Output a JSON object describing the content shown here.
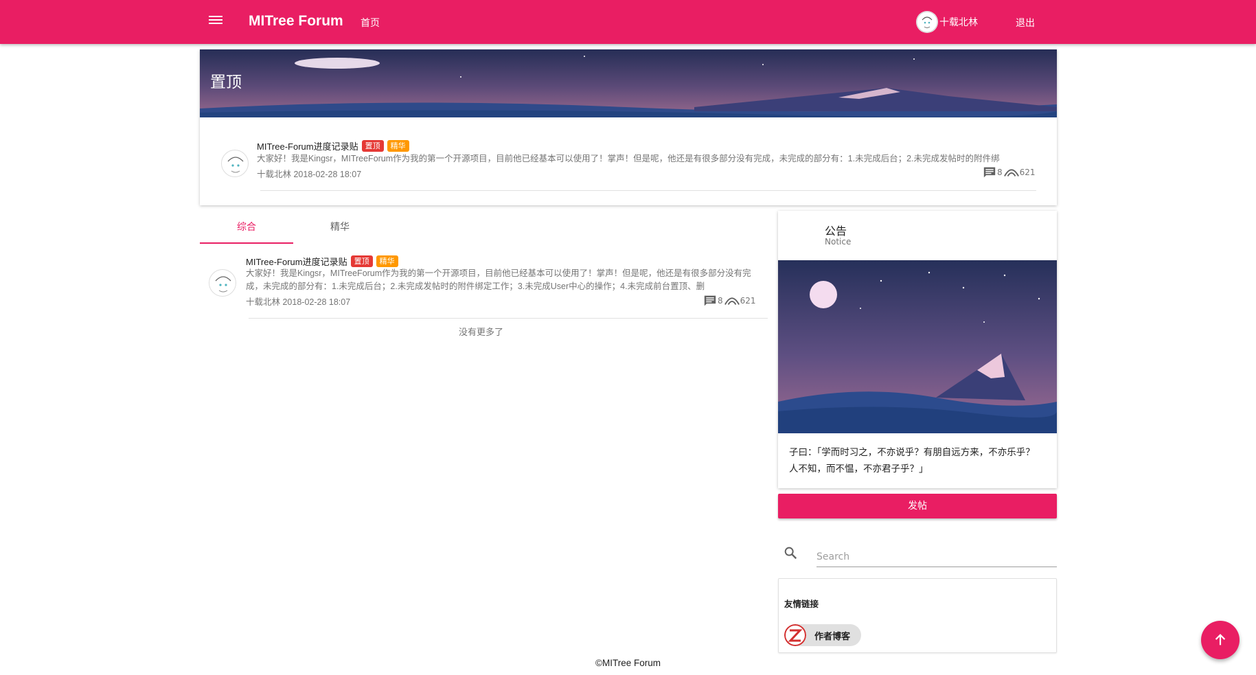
{
  "header": {
    "app_title": "MITree Forum",
    "nav_home": "首页",
    "user_name": "十载北林",
    "logout": "退出",
    "menu_icon": "menu-icon",
    "accent_color": "#e91e63"
  },
  "pinned": {
    "title": "置顶",
    "post": {
      "title": "MITree-Forum进度记录贴",
      "tag_top": "置顶",
      "tag_elite": "精华",
      "excerpt": "大家好！我是Kingsr，MITreeForum作为我的第一个开源项目，目前他已经基本可以使用了！掌声！但是呢，他还是有很多部分没有完成，未完成的部分有：1.未完成后台；2.未完成发帖时的附件绑",
      "meta": "十载北林 2018-02-28 18:07",
      "comments": "8",
      "views": "621"
    }
  },
  "tabs": [
    {
      "label": "综合",
      "active": true
    },
    {
      "label": "精华",
      "active": false
    }
  ],
  "feed": {
    "posts": [
      {
        "title": "MITree-Forum进度记录贴",
        "tag_top": "置顶",
        "tag_elite": "精华",
        "excerpt": "大家好！我是Kingsr，MITreeForum作为我的第一个开源项目，目前他已经基本可以使用了！掌声！但是呢，他还是有很多部分没有完成，未完成的部分有：1.未完成后台；2.未完成发帖时的附件绑定工作；3.未完成User中心的操作；4.未完成前台置顶、删",
        "meta": "十载北林 2018-02-28 18:07",
        "comments": "8",
        "views": "621"
      }
    ],
    "no_more": "没有更多了"
  },
  "sidebar": {
    "notice_title": "公告",
    "notice_subtitle": "Notice",
    "notice_text": "子曰：「学而时习之，不亦说乎？有朋自远方来，不亦乐乎？人不知，而不愠，不亦君子乎？」",
    "post_button": "发帖",
    "search_placeholder": "Search",
    "links_title": "友情链接",
    "links": [
      {
        "label": "作者博客"
      }
    ]
  },
  "footer": {
    "text": "©MITree Forum"
  }
}
